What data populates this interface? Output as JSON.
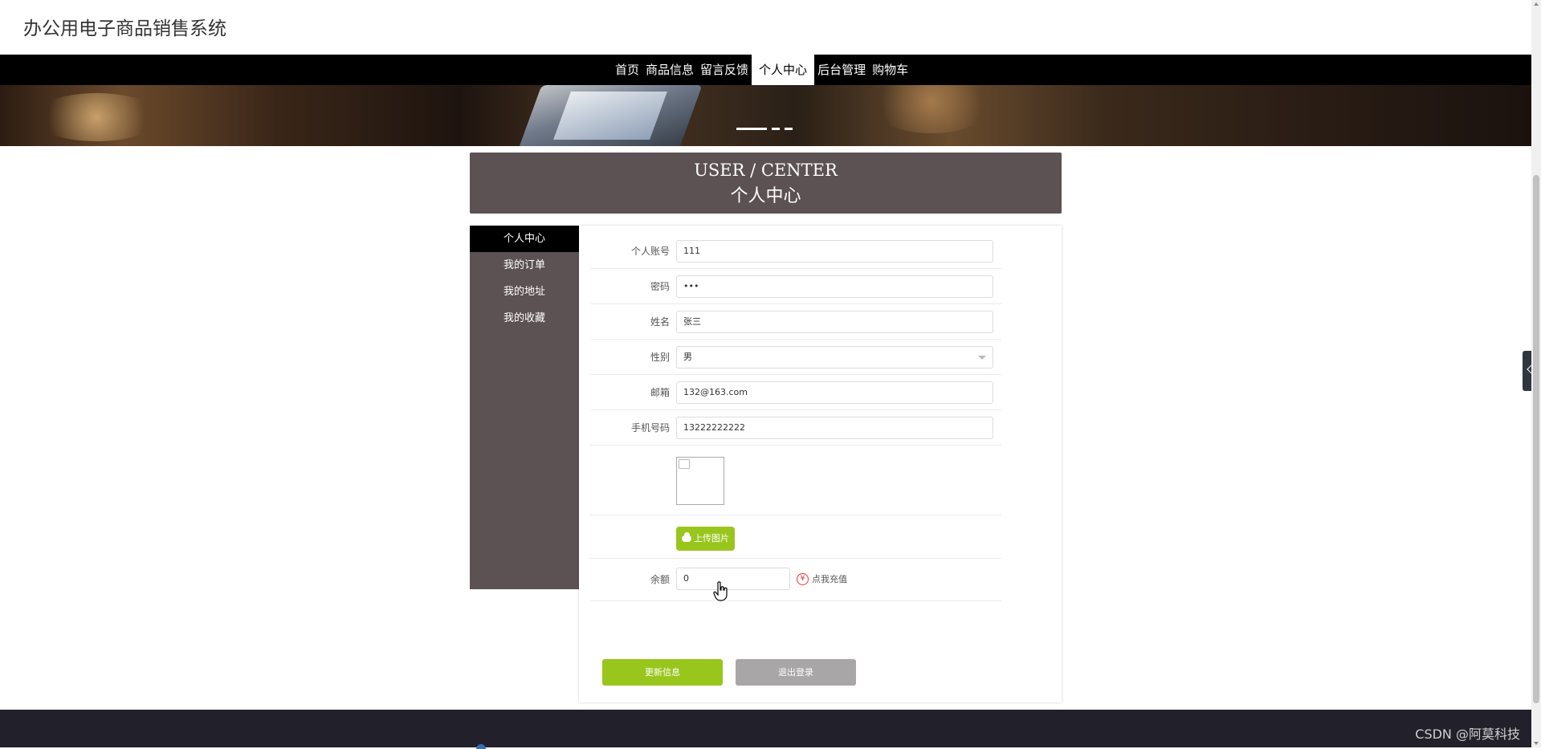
{
  "header": {
    "site_title": "办公用电子商品销售系统"
  },
  "nav": {
    "items": [
      {
        "label": "首页",
        "active": false
      },
      {
        "label": "商品信息",
        "active": false
      },
      {
        "label": "留言反馈",
        "active": false
      },
      {
        "label": "个人中心",
        "active": true
      },
      {
        "label": "后台管理",
        "active": false
      },
      {
        "label": "购物车",
        "active": false
      }
    ]
  },
  "banner": {
    "slide_count": 3,
    "active_slide": 1
  },
  "title_box": {
    "english": "USER / CENTER",
    "chinese": "个人中心"
  },
  "side_menu": {
    "items": [
      {
        "label": "个人中心",
        "active": true
      },
      {
        "label": "我的订单",
        "active": false
      },
      {
        "label": "我的地址",
        "active": false
      },
      {
        "label": "我的收藏",
        "active": false
      }
    ]
  },
  "form": {
    "account": {
      "label": "个人账号",
      "value": "111"
    },
    "password": {
      "label": "密码",
      "value": "•••"
    },
    "name": {
      "label": "姓名",
      "value": "张三"
    },
    "gender": {
      "label": "性别",
      "value": "男"
    },
    "email": {
      "label": "邮箱",
      "value": "132@163.com"
    },
    "phone": {
      "label": "手机号码",
      "value": "13222222222"
    },
    "upload_label": "上传图片",
    "balance": {
      "label": "余额",
      "value": "0"
    },
    "recharge_label": "点我充值",
    "recharge_icon": "¥",
    "update_label": "更新信息",
    "logout_label": "退出登录"
  },
  "footer": {
    "watermark": "CSDN @阿莫科技"
  },
  "colors": {
    "nav_bg": "#000000",
    "panel_bg": "#5c5253",
    "accent_green": "#99c61d",
    "gray_button": "#a8a6a7",
    "footer_bg": "#22202a"
  }
}
